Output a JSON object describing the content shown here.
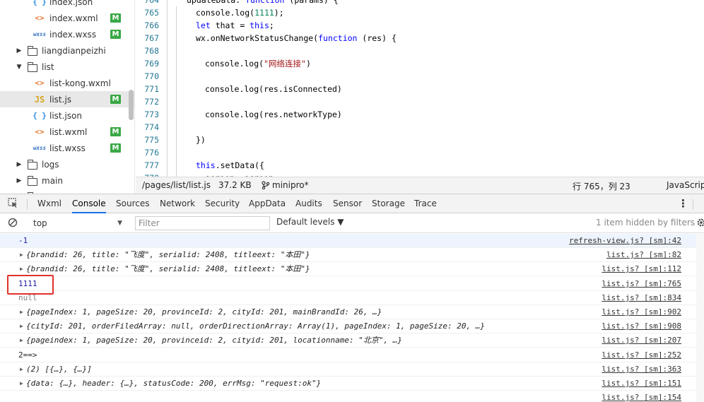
{
  "file_tree": {
    "items": [
      {
        "label": "index.json",
        "icon": "json-file-icon",
        "depth": 2,
        "badge": ""
      },
      {
        "label": "index.wxml",
        "icon": "wxml-file-icon",
        "depth": 2,
        "badge": "M"
      },
      {
        "label": "index.wxss",
        "icon": "wxss-file-icon",
        "depth": 2,
        "badge": "M"
      },
      {
        "label": "liangdianpeizhi",
        "icon": "folder-icon",
        "depth": 1,
        "badge": "",
        "expanded": false
      },
      {
        "label": "list",
        "icon": "folder-icon",
        "depth": 1,
        "badge": "",
        "expanded": true
      },
      {
        "label": "list-kong.wxml",
        "icon": "wxml-file-icon",
        "depth": 2,
        "badge": ""
      },
      {
        "label": "list.js",
        "icon": "js-file-icon",
        "depth": 2,
        "badge": "M",
        "selected": true
      },
      {
        "label": "list.json",
        "icon": "json-file-icon",
        "depth": 2,
        "badge": ""
      },
      {
        "label": "list.wxml",
        "icon": "wxml-file-icon",
        "depth": 2,
        "badge": "M"
      },
      {
        "label": "list.wxss",
        "icon": "wxss-file-icon",
        "depth": 2,
        "badge": "M"
      },
      {
        "label": "logs",
        "icon": "folder-icon",
        "depth": 1,
        "badge": "",
        "expanded": false
      },
      {
        "label": "main",
        "icon": "folder-icon",
        "depth": 1,
        "badge": "",
        "expanded": false
      },
      {
        "label": "my",
        "icon": "folder-icon",
        "depth": 1,
        "badge": "",
        "expanded": false
      }
    ],
    "icon_glyphs": {
      "wxml": "<>",
      "wxss": "wxss",
      "js": "JS",
      "json": "{ }"
    }
  },
  "editor": {
    "lines": [
      {
        "num": "764",
        "text": "updateData: function (params) {",
        "indent": 1
      },
      {
        "num": "765",
        "text": "console.log(1111);",
        "indent": 2
      },
      {
        "num": "766",
        "text": "let that = this;",
        "indent": 2
      },
      {
        "num": "767",
        "text": "wx.onNetworkStatusChange(function (res) {",
        "indent": 2
      },
      {
        "num": "768",
        "text": "",
        "indent": 3
      },
      {
        "num": "769",
        "text": "console.log(\"网络连接\")",
        "indent": 3
      },
      {
        "num": "770",
        "text": "",
        "indent": 3
      },
      {
        "num": "771",
        "text": "console.log(res.isConnected)",
        "indent": 3
      },
      {
        "num": "772",
        "text": "",
        "indent": 3
      },
      {
        "num": "773",
        "text": "console.log(res.networkType)",
        "indent": 3
      },
      {
        "num": "774",
        "text": "",
        "indent": 3
      },
      {
        "num": "775",
        "text": "})",
        "indent": 2
      },
      {
        "num": "776",
        "text": "",
        "indent": 2
      },
      {
        "num": "777",
        "text": "this.setData({",
        "indent": 2
      },
      {
        "num": "778",
        "text": "screen: screen,",
        "indent": 3
      }
    ]
  },
  "statusbar": {
    "path": "/pages/list/list.js",
    "size": "37.2 KB",
    "branch_icon": "git-branch-icon",
    "branch": "minipro*",
    "cursor": "行 765，列 23",
    "language": "JavaScript"
  },
  "devtools": {
    "inspect_icon": "inspect-element-icon",
    "tabs": [
      "Wxml",
      "Console",
      "Sources",
      "Network",
      "Security",
      "AppData",
      "Audits",
      "Sensor",
      "Storage",
      "Trace"
    ],
    "active_tab": "Console",
    "more_icon": "more-vert-icon"
  },
  "console_toolbar": {
    "clear_icon": "clear-console-icon",
    "context": "top",
    "filter_placeholder": "Filter",
    "levels": "Default levels ▼",
    "hidden_note": "1 item hidden by filters",
    "settings_icon": "gear-icon"
  },
  "console": {
    "logs": [
      {
        "text": "-1",
        "type": "num",
        "expandable": false,
        "source": "refresh-view.js? [sm]:42"
      },
      {
        "text": "{brandid: 26, title: \"飞度\", serialid: 2408, titleext: \"本田\"}",
        "type": "obj",
        "expandable": true,
        "source": "list.js? [sm]:82"
      },
      {
        "text": "{brandid: 26, title: \"飞度\", serialid: 2408, titleext: \"本田\"}",
        "type": "obj",
        "expandable": true,
        "source": "list.js? [sm]:112"
      },
      {
        "text": "1111",
        "type": "num",
        "expandable": false,
        "source": "list.js? [sm]:765"
      },
      {
        "text": "null",
        "type": "muted",
        "expandable": false,
        "source": "list.js? [sm]:834"
      },
      {
        "text": "{pageIndex: 1, pageSize: 20, provinceId: 2, cityId: 201, mainBrandId: 26, …}",
        "type": "obj",
        "expandable": true,
        "source": "list.js? [sm]:902"
      },
      {
        "text": "{cityId: 201, orderFiledArray: null, orderDirectionArray: Array(1), pageIndex: 1, pageSize: 20, …}",
        "type": "obj",
        "expandable": true,
        "source": "list.js? [sm]:908"
      },
      {
        "text": "{pageindex: 1, pageSize: 20, provinceid: 2, cityid: 201, locationname: \"北京\", …}",
        "type": "obj",
        "expandable": true,
        "source": "list.js? [sm]:207"
      },
      {
        "text": "2==>",
        "type": "plain",
        "expandable": false,
        "source": "list.js? [sm]:252"
      },
      {
        "text": "(2) [{…}, {…}]",
        "type": "obj",
        "expandable": true,
        "source": "list.js? [sm]:363"
      },
      {
        "text": "{data: {…}, header: {…}, statusCode: 200, errMsg: \"request:ok\"}",
        "type": "obj",
        "expandable": true,
        "source": "list.js? [sm]:151"
      },
      {
        "text": "",
        "type": "plain",
        "expandable": false,
        "source": "list.js? [sm]:154"
      }
    ]
  },
  "colors": {
    "badge_modified": "#39a845",
    "active_tab_underline": "#1a73e8",
    "highlight_box": "#e0322b",
    "number_value": "#1a1aa6",
    "line_number": "#237893"
  }
}
